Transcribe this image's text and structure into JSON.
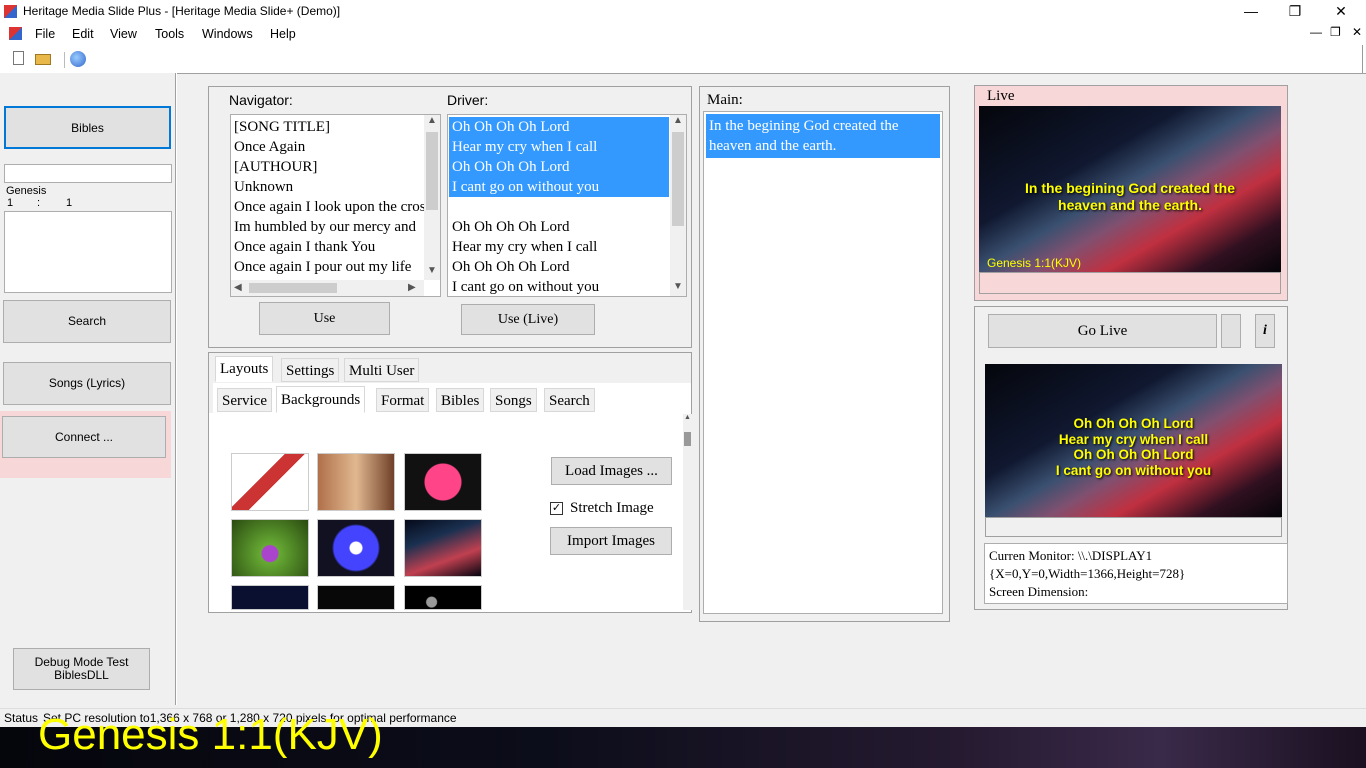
{
  "window": {
    "title": "Heritage Media Slide Plus - [Heritage Media Slide+ (Demo)]"
  },
  "menu": [
    "File",
    "Edit",
    "View",
    "Tools",
    "Windows",
    "Help"
  ],
  "sidebar": {
    "bibles": "Bibles",
    "book": "Genesis",
    "chapter": "1",
    "colon": ":",
    "verse": "1",
    "search": "Search",
    "songs": "Songs (Lyrics)",
    "connect": "Connect ...",
    "debug_line1": "Debug Mode Test",
    "debug_line2": "BiblesDLL"
  },
  "navigator": {
    "label": "Navigator:",
    "items": [
      "[SONG TITLE]",
      "Once Again",
      "[AUTHOUR]",
      "Unknown",
      "Once again I look upon the cross",
      "Im humbled by our mercy and",
      "Once again I thank You",
      "Once again I pour out my life"
    ],
    "use_button": "Use"
  },
  "driver": {
    "label": "Driver:",
    "items": [
      "Oh Oh Oh Oh Lord",
      "Hear my cry when I call",
      "Oh Oh Oh Oh Lord",
      "I cant go on without you",
      "",
      "Oh Oh Oh Oh Lord",
      "Hear my cry when I call",
      "Oh Oh Oh Oh Lord",
      "I cant go on without you"
    ],
    "use_live_button": "Use (Live)"
  },
  "main": {
    "label": "Main:",
    "text": "In the begining God created the heaven and the earth."
  },
  "tabs": {
    "top": [
      "Layouts",
      "Settings",
      "Multi User"
    ],
    "sub": [
      "Service",
      "Backgrounds",
      "Format",
      "Bibles",
      "Songs",
      "Search"
    ],
    "load_images": "Load Images ...",
    "stretch_image": "Stretch Image",
    "import_images": "Import Images"
  },
  "live": {
    "label": "Live",
    "line1": "In the begining God created the",
    "line2": "heaven and the earth.",
    "reference": "Genesis 1:1(KJV)"
  },
  "preview": {
    "go_live": "Go Live",
    "info": "i",
    "lines": [
      "Oh Oh Oh Oh Lord",
      "Hear my cry when I call",
      "Oh Oh Oh Oh Lord",
      "I cant go on without you"
    ]
  },
  "monitor": {
    "line1": "Curren Monitor: \\\\.\\DISPLAY1",
    "line2": "{X=0,Y=0,Width=1366,Height=728}",
    "line3": "Screen Dimension:"
  },
  "status": {
    "label": "Status",
    "text": "Set PC resolution to1,366 x 768 or 1,280 x 720 pixels  for optimal performance"
  },
  "footer_overlay": "Genesis 1:1(KJV)",
  "colors": {
    "accent": "#3399ff",
    "live_panel": "#f7d7d7",
    "overlay_text": "#ffff00"
  }
}
